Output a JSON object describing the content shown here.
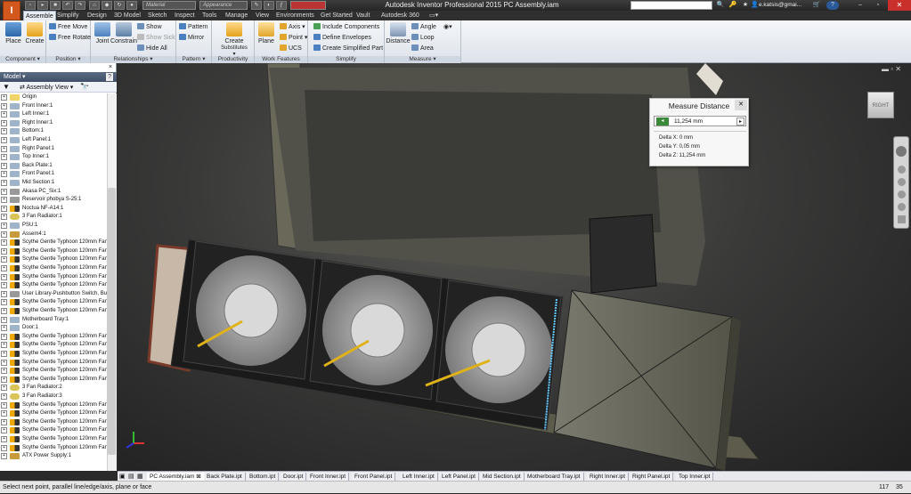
{
  "app": {
    "title": "Autodesk Inventor Professional 2015   PC Assembly.iam",
    "logo_letter": "I",
    "material_placeholder": "Material",
    "appearance_placeholder": "Appearance",
    "user": "e.katsis@gmai...",
    "help": "?",
    "minimize": "–",
    "restore": "▫",
    "close": "✕"
  },
  "ribbon_tabs": [
    "Assemble",
    "Simplify",
    "Design",
    "3D Model",
    "Sketch",
    "Inspect",
    "Tools",
    "Manage",
    "View",
    "Environments",
    "Get Started",
    "Vault",
    "Autodesk 360"
  ],
  "ribbon": {
    "component": {
      "label": "Component ▾",
      "place": "Place",
      "create": "Create"
    },
    "position": {
      "label": "Position ▾",
      "free_move": "Free Move",
      "free_rotate": "Free Rotate"
    },
    "relationships": {
      "label": "Relationships ▾",
      "joint": "Joint",
      "constrain": "Constrain",
      "show": "Show",
      "show_sick": "Show Sick",
      "hide_all": "Hide All"
    },
    "pattern": {
      "label": "Pattern ▾",
      "pattern": "Pattern",
      "mirror": "Mirror"
    },
    "productivity": {
      "label": "Productivity",
      "create": "Create",
      "substitutes": "Substitutes ▾"
    },
    "work_features": {
      "label": "Work Features",
      "plane": "Plane",
      "axis": "Axis ▾",
      "point": "Point ▾",
      "ucs": "UCS"
    },
    "simplify": {
      "label": "Simplify",
      "include": "Include Components",
      "define": "Define Envelopes",
      "create": "Create Simplified Part"
    },
    "measure": {
      "label": "Measure ▾",
      "distance": "Distance",
      "angle": "Angle",
      "loop": "Loop",
      "area": "Area"
    }
  },
  "browser": {
    "header": "Model ▾",
    "view_label": "Assembly View",
    "items": [
      {
        "label": "Origin",
        "icon": "fold"
      },
      {
        "label": "Front Inner:1",
        "icon": "part"
      },
      {
        "label": "Left Inner:1",
        "icon": "part"
      },
      {
        "label": "Right Inner:1",
        "icon": "part"
      },
      {
        "label": "Bottom:1",
        "icon": "part"
      },
      {
        "label": "Left Panel:1",
        "icon": "part"
      },
      {
        "label": "Right Panel:1",
        "icon": "part"
      },
      {
        "label": "Top Inner:1",
        "icon": "part"
      },
      {
        "label": "Back Plate:1",
        "icon": "part"
      },
      {
        "label": "Front Panel:1",
        "icon": "part"
      },
      {
        "label": "Mid Section:1",
        "icon": "part"
      },
      {
        "label": "Akasa PC_Six:1",
        "icon": "grey"
      },
      {
        "label": "Reservoir phobya S-25:1",
        "icon": "grey"
      },
      {
        "label": "Noctua NF-A14:1",
        "icon": "fan"
      },
      {
        "label": "3 Fan Radiator:1",
        "icon": "rad"
      },
      {
        "label": "PSU:1",
        "icon": "part"
      },
      {
        "label": "Assem4:1",
        "icon": "asm"
      },
      {
        "label": "Scythe Gentle Typhoon 120mm Fan:1",
        "icon": "fan"
      },
      {
        "label": "Scythe Gentle Typhoon 120mm Fan:2",
        "icon": "fan"
      },
      {
        "label": "Scythe Gentle Typhoon 120mm Fan:3",
        "icon": "fan"
      },
      {
        "label": "Scythe Gentle Typhoon 120mm Fan:4",
        "icon": "fan"
      },
      {
        "label": "Scythe Gentle Typhoon 120mm Fan:5",
        "icon": "fan"
      },
      {
        "label": "Scythe Gentle Typhoon 120mm Fan:6",
        "icon": "fan"
      },
      {
        "label": "User Library-Pushbutton Switch, Bulg",
        "icon": "grey"
      },
      {
        "label": "Scythe Gentle Typhoon 120mm Fan:7",
        "icon": "fan"
      },
      {
        "label": "Scythe Gentle Typhoon 120mm Fan:8",
        "icon": "fan"
      },
      {
        "label": "Motherboard Tray:1",
        "icon": "part"
      },
      {
        "label": "Door:1",
        "icon": "part"
      },
      {
        "label": "Scythe Gentle Typhoon 120mm Fan:9",
        "icon": "fan"
      },
      {
        "label": "Scythe Gentle Typhoon 120mm Fan:1",
        "icon": "fan"
      },
      {
        "label": "Scythe Gentle Typhoon 120mm Fan:1",
        "icon": "fan"
      },
      {
        "label": "Scythe Gentle Typhoon 120mm Fan:1",
        "icon": "fan"
      },
      {
        "label": "Scythe Gentle Typhoon 120mm Fan:1",
        "icon": "fan"
      },
      {
        "label": "Scythe Gentle Typhoon 120mm Fan:1",
        "icon": "fan"
      },
      {
        "label": "3 Fan Radiator:2",
        "icon": "rad"
      },
      {
        "label": "3 Fan Radiator:3",
        "icon": "rad"
      },
      {
        "label": "Scythe Gentle Typhoon 120mm Fan:1",
        "icon": "fan"
      },
      {
        "label": "Scythe Gentle Typhoon 120mm Fan:1",
        "icon": "fan"
      },
      {
        "label": "Scythe Gentle Typhoon 120mm Fan:1",
        "icon": "fan"
      },
      {
        "label": "Scythe Gentle Typhoon 120mm Fan:1",
        "icon": "fan"
      },
      {
        "label": "Scythe Gentle Typhoon 120mm Fan:1",
        "icon": "fan"
      },
      {
        "label": "Scythe Gentle Typhoon 120mm Fan:2",
        "icon": "fan"
      },
      {
        "label": "ATX Power Supply:1",
        "icon": "asm"
      }
    ]
  },
  "measure_distance": {
    "title": "Measure Distance",
    "value": "11,254 mm",
    "delta_x": "Delta X: 0 mm",
    "delta_y": "Delta Y: 0,05 mm",
    "delta_z": "Delta Z: 11,254 mm"
  },
  "viewcube_label": "RIGHT",
  "doc_tabs": [
    "PC Assembly.iam",
    "Back Plate.ipt",
    "Bottom.ipt",
    "Door.ipt",
    "Front Inner.ipt",
    "Front Panel.ipt",
    "Left Inner.ipt",
    "Left Panel.ipt",
    "Mid Section.ipt",
    "Motherboard Tray.ipt",
    "Right Inner.ipt",
    "Right Panel.ipt",
    "Top Inner.ipt"
  ],
  "status": {
    "prompt": "Select next point, parallel line/edge/axis, plane or face",
    "n1": "117",
    "n2": "35"
  }
}
